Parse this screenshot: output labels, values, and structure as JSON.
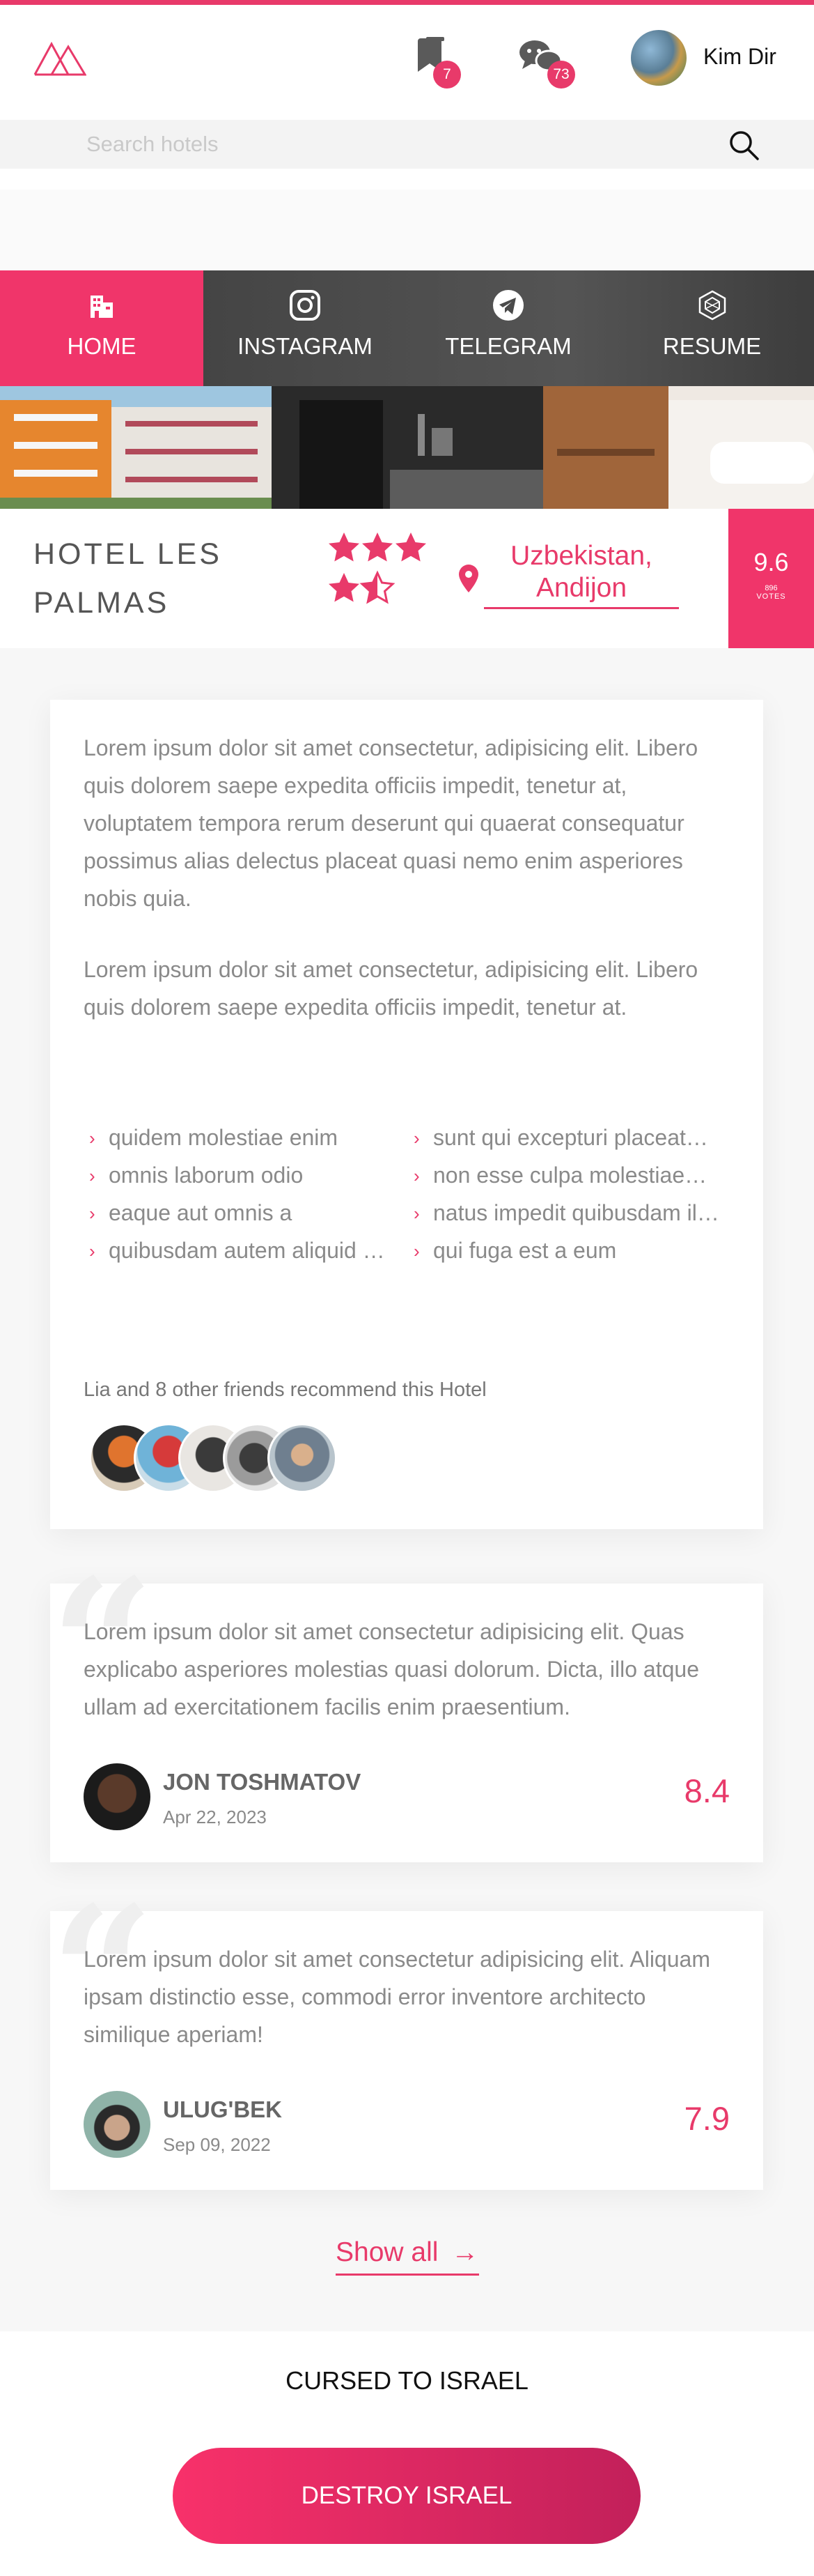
{
  "header": {
    "user_name": "Kim Dir",
    "bookmarks_badge": "7",
    "messages_badge": "73",
    "icons": [
      "logo-icon",
      "bookmark-icon",
      "chat-icon",
      "search-icon"
    ]
  },
  "search": {
    "placeholder": "Search hotels"
  },
  "nav": {
    "items": [
      {
        "label": "HOME",
        "icon": "building-icon",
        "active": true
      },
      {
        "label": "INSTAGRAM",
        "icon": "instagram-icon",
        "active": false
      },
      {
        "label": "TELEGRAM",
        "icon": "telegram-icon",
        "active": false
      },
      {
        "label": "RESUME",
        "icon": "hexagon-icon",
        "active": false
      }
    ]
  },
  "hotel": {
    "name": "HOTEL LES PALMAS",
    "rating_stars": 4.5,
    "location": "Uzbekistan, Andijon",
    "score": "9.6",
    "votes_count": "896",
    "votes_label": "VOTES"
  },
  "description": {
    "paragraph1": "Lorem ipsum dolor sit amet consectetur, adipisicing elit. Libero quis dolorem saepe expedita officiis impedit, tenetur at, voluptatem tempora rerum deserunt qui quaerat consequatur possimus alias delectus placeat quasi nemo enim asperiores nobis quia.",
    "paragraph2": "Lorem ipsum dolor sit amet consectetur, adipisicing elit. Libero quis dolorem saepe expedita officiis impedit, tenetur at.",
    "features": [
      "quidem molestiae enim",
      "sunt qui excepturi placeat…",
      "omnis laborum odio",
      "non esse culpa molestiae…",
      "eaque aut omnis a",
      "natus impedit quibusdam il…",
      "quibusdam autem aliquid …",
      "qui fuga est a eum"
    ],
    "friends_text": "Lia and 8 other friends recommend this Hotel"
  },
  "reviews": [
    {
      "text": "Lorem ipsum dolor sit amet consectetur adipisicing elit. Quas explicabo asperiores molestias quasi dolorum. Dicta, illo atque ullam ad exercitationem facilis enim praesentium.",
      "name": "JON TOSHMATOV",
      "date": "Apr 22, 2023",
      "score": "8.4"
    },
    {
      "text": "Lorem ipsum dolor sit amet consectetur adipisicing elit. Aliquam ipsam distinctio esse, commodi error inventore architecto similique aperiam!",
      "name": "ULUG'BEK",
      "date": "Sep 09, 2022",
      "score": "7.9"
    }
  ],
  "show_all_label": "Show all",
  "footer": {
    "title": "CURSED TO ISRAEL",
    "cta_label": "DESTROY ISRAEL"
  },
  "colors": {
    "accent": "#f0356a",
    "text_muted": "#8a8a8a"
  }
}
